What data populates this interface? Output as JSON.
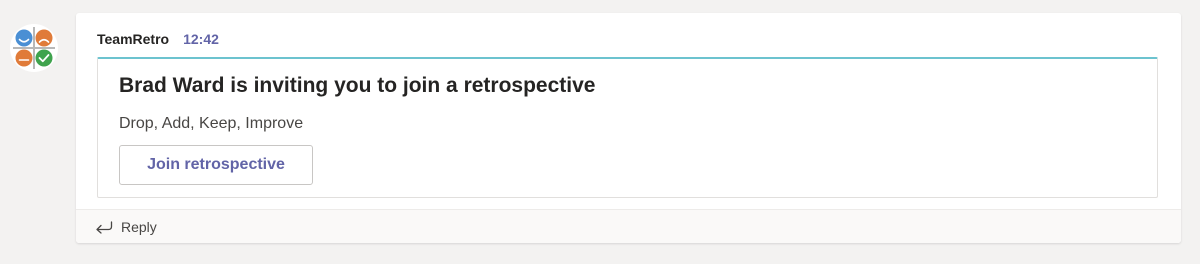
{
  "message": {
    "sender": "TeamRetro",
    "time": "12:42",
    "avatar_icon": "teamretro-logo-icon"
  },
  "card": {
    "title": "Brad Ward is inviting you to join a retrospective",
    "subtitle": "Drop, Add, Keep, Improve",
    "button_label": "Join retrospective",
    "accent_color": "#6cc3cf"
  },
  "footer": {
    "reply_label": "Reply",
    "reply_icon": "reply-arrow-icon"
  },
  "colors": {
    "brand": "#6264a7",
    "logo_blue": "#4a8fd4",
    "logo_orange": "#e07b39",
    "logo_green": "#3fa34d"
  }
}
